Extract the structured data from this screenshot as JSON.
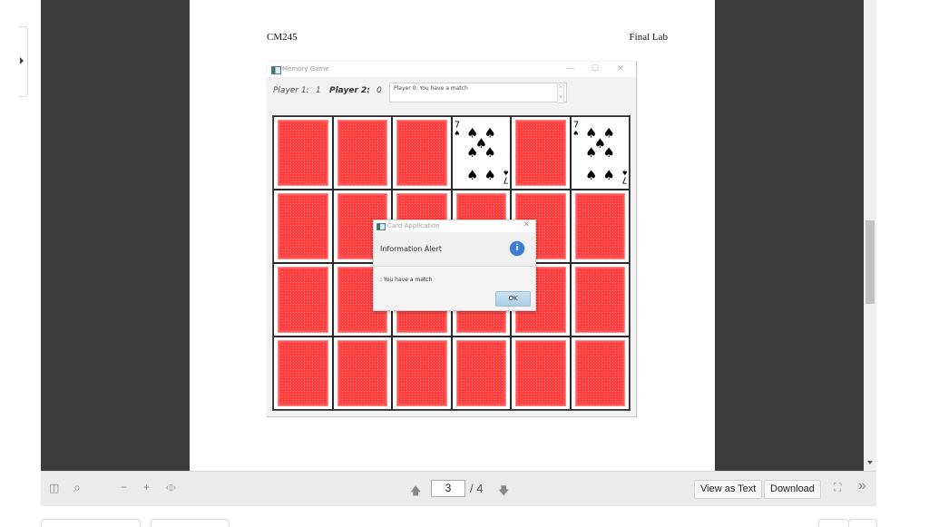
{
  "document": {
    "header_left": "CM245",
    "header_right": "Final Lab"
  },
  "game_window": {
    "title": "Memory Game",
    "controls": {
      "minimize": "—",
      "maximize": "☐",
      "close": "✕"
    },
    "player1_label": "Player 1:",
    "player1_score": "1",
    "player2_label": "Player 2:",
    "player2_score": "0",
    "message": "Player 0: You have a match",
    "board": {
      "rows": 4,
      "cols": 6,
      "cards": [
        "back",
        "back",
        "back",
        "7-spades",
        "back",
        "7-spades",
        "back",
        "back",
        "back",
        "back",
        "back",
        "back",
        "back",
        "back",
        "back",
        "back",
        "back",
        "back",
        "back",
        "back",
        "back",
        "back",
        "back",
        "back"
      ],
      "face_rank": "7",
      "face_suit": "♠"
    }
  },
  "dialog": {
    "title": "Card Application",
    "close": "✕",
    "header": "Information Alert",
    "info_icon": "i",
    "message": ": You have a match",
    "ok_label": "OK"
  },
  "viewer_toolbar": {
    "sidebar_icon": "◫",
    "search_icon": "⌕",
    "zoom_out": "−",
    "zoom_in": "+",
    "fit_icon": "‹▯›",
    "page_up": "🡅",
    "current_page": "3",
    "total_pages": "/ 4",
    "page_down": "🡇",
    "view_as_text": "View as Text",
    "download": "Download",
    "fullscreen_icon": "⛶",
    "more_icon": "»"
  },
  "scroll": {
    "position_fraction": 0.47
  }
}
